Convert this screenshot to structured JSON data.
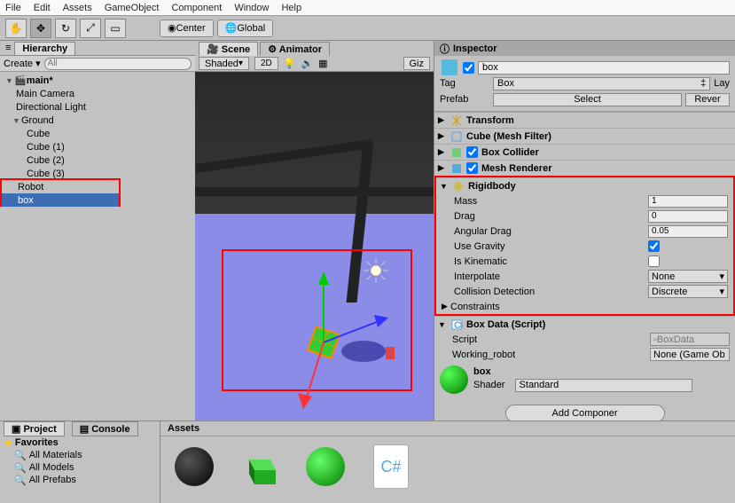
{
  "menu": [
    "File",
    "Edit",
    "Assets",
    "GameObject",
    "Component",
    "Window",
    "Help"
  ],
  "toolbar": {
    "center": "Center",
    "global": "Global"
  },
  "hierarchy": {
    "title": "Hierarchy",
    "create": "Create",
    "search_ph": "All",
    "root": "main*",
    "items": [
      "Main Camera",
      "Directional Light"
    ],
    "ground": "Ground",
    "cubes": [
      "Cube",
      "Cube (1)",
      "Cube (2)",
      "Cube (3)"
    ],
    "robot": "Robot",
    "box": "box"
  },
  "scene": {
    "tab1": "Scene",
    "tab2": "Animator",
    "shaded": "Shaded",
    "mode2d": "2D",
    "giz": "Giz"
  },
  "inspector": {
    "title": "Inspector",
    "name": "box",
    "tag_label": "Tag",
    "tag": "Box",
    "layer": "Lay",
    "prefab": "Prefab",
    "select": "Select",
    "revert": "Rever",
    "components": {
      "transform": "Transform",
      "mesh_filter": "Cube (Mesh Filter)",
      "box_collider": "Box Collider",
      "mesh_renderer": "Mesh Renderer",
      "rigidbody": {
        "title": "Rigidbody",
        "mass_l": "Mass",
        "mass": "1",
        "drag_l": "Drag",
        "drag": "0",
        "ang_l": "Angular Drag",
        "ang": "0.05",
        "grav_l": "Use Gravity",
        "grav": true,
        "kin_l": "Is Kinematic",
        "kin": false,
        "interp_l": "Interpolate",
        "interp": "None",
        "coll_l": "Collision Detection",
        "coll": "Discrete",
        "constraints": "Constraints"
      },
      "box_data": {
        "title": "Box Data (Script)",
        "script_l": "Script",
        "script": "BoxData",
        "robot_l": "Working_robot",
        "robot": "None (Game Ob"
      }
    },
    "material": {
      "name": "box",
      "shader_l": "Shader",
      "shader": "Standard"
    },
    "add": "Add Componer"
  },
  "project": {
    "tab1": "Project",
    "tab2": "Console",
    "favorites": "Favorites",
    "favs": [
      "All Materials",
      "All Models",
      "All Prefabs"
    ],
    "assets": "Assets"
  }
}
